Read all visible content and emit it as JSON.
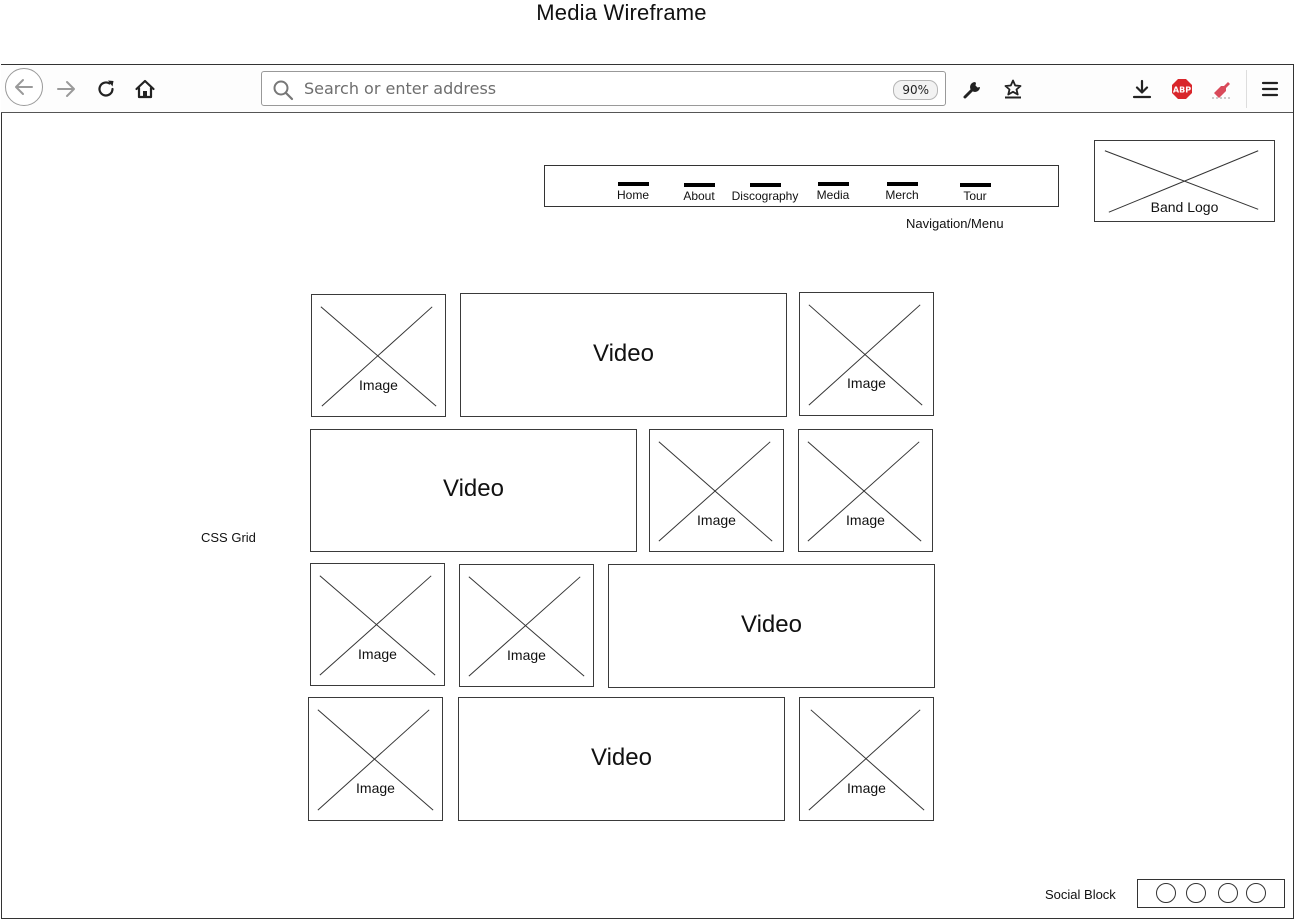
{
  "page_title": "Media Wireframe",
  "browser": {
    "address_placeholder": "Search or enter address",
    "zoom_level": "90%",
    "toolbar_icons": [
      "back-arrow-icon",
      "forward-arrow-icon",
      "reload-icon",
      "home-icon",
      "search-icon",
      "wrench-icon",
      "bookmark-star-icon",
      "download-icon",
      "adblock-icon",
      "extension-icon",
      "hamburger-menu-icon"
    ],
    "adblock_badge": "ABP",
    "adblock_color": "#d9262b",
    "extension_color": "#d94a5a"
  },
  "navigation": {
    "items": [
      "Home",
      "About",
      "Discography",
      "Media",
      "Merch",
      "Tour"
    ],
    "annotation": "Navigation/Menu"
  },
  "logo": {
    "label": "Band Logo"
  },
  "grid": {
    "annotation": "CSS Grid",
    "rows": [
      [
        "Image",
        "Video",
        "Image"
      ],
      [
        "Video",
        "Image",
        "Image"
      ],
      [
        "Image",
        "Image",
        "Video"
      ],
      [
        "Image",
        "Video",
        "Image"
      ]
    ]
  },
  "social": {
    "annotation": "Social Block",
    "icon_count": 4
  }
}
